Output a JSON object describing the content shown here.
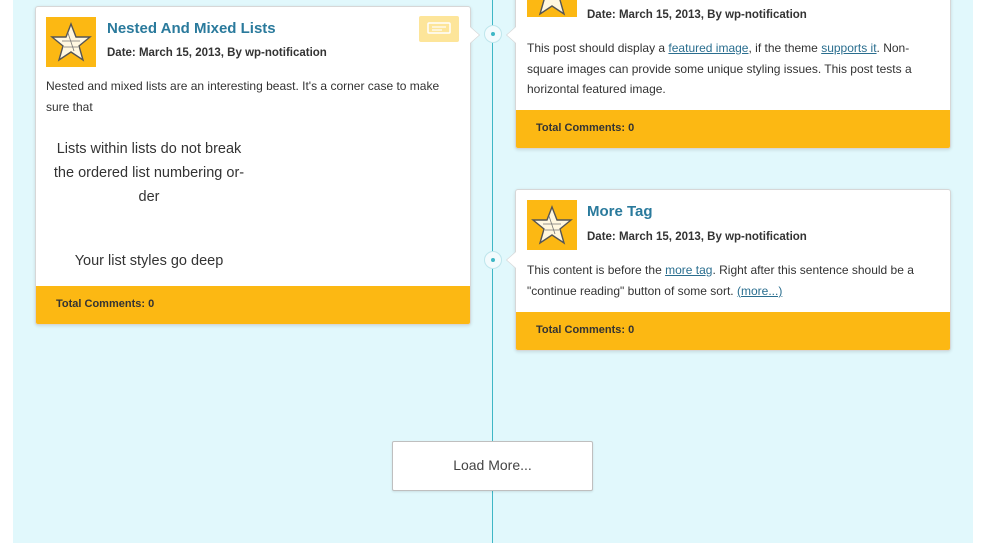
{
  "posts": [
    {
      "title": "Nested And Mixed Lists",
      "meta": "Date: March 15, 2013, By wp-notification",
      "excerpt": "Nested and mixed lists are an interesting beast. It's a corner case to make sure that",
      "list_items": [
        "Lists within lists do not break the ordered list numbering or-",
        "der",
        "Your list styles go deep"
      ],
      "comments": "Total Comments: 0",
      "format_icon": "chat-bubble-icon"
    },
    {
      "title": "",
      "meta": "Date: March 15, 2013, By wp-notification",
      "excerpt_parts": [
        "This post should display a ",
        "featured image",
        ", if the theme ",
        "supports it",
        ". Non-square images can provide some unique styling issues. This post tests a horizontal featured image."
      ],
      "comments": "Total Comments: 0"
    },
    {
      "title": "More Tag",
      "meta": "Date: March 15, 2013, By wp-notification",
      "excerpt_parts": [
        "This content is before the ",
        "more tag",
        ". Right after this sentence should be a \"continue reading\" button of some sort. ",
        "(more...)"
      ],
      "comments": "Total Comments: 0"
    }
  ],
  "load_more_label": "Load More...",
  "colors": {
    "background": "#e1f8fc",
    "timeline": "#3fb7c6",
    "accent": "#fcb813",
    "title": "#2a7a9c",
    "link": "#2a6e8f"
  },
  "icons": {
    "avatar": "star-avatar-icon",
    "node": "timeline-dot-icon"
  }
}
